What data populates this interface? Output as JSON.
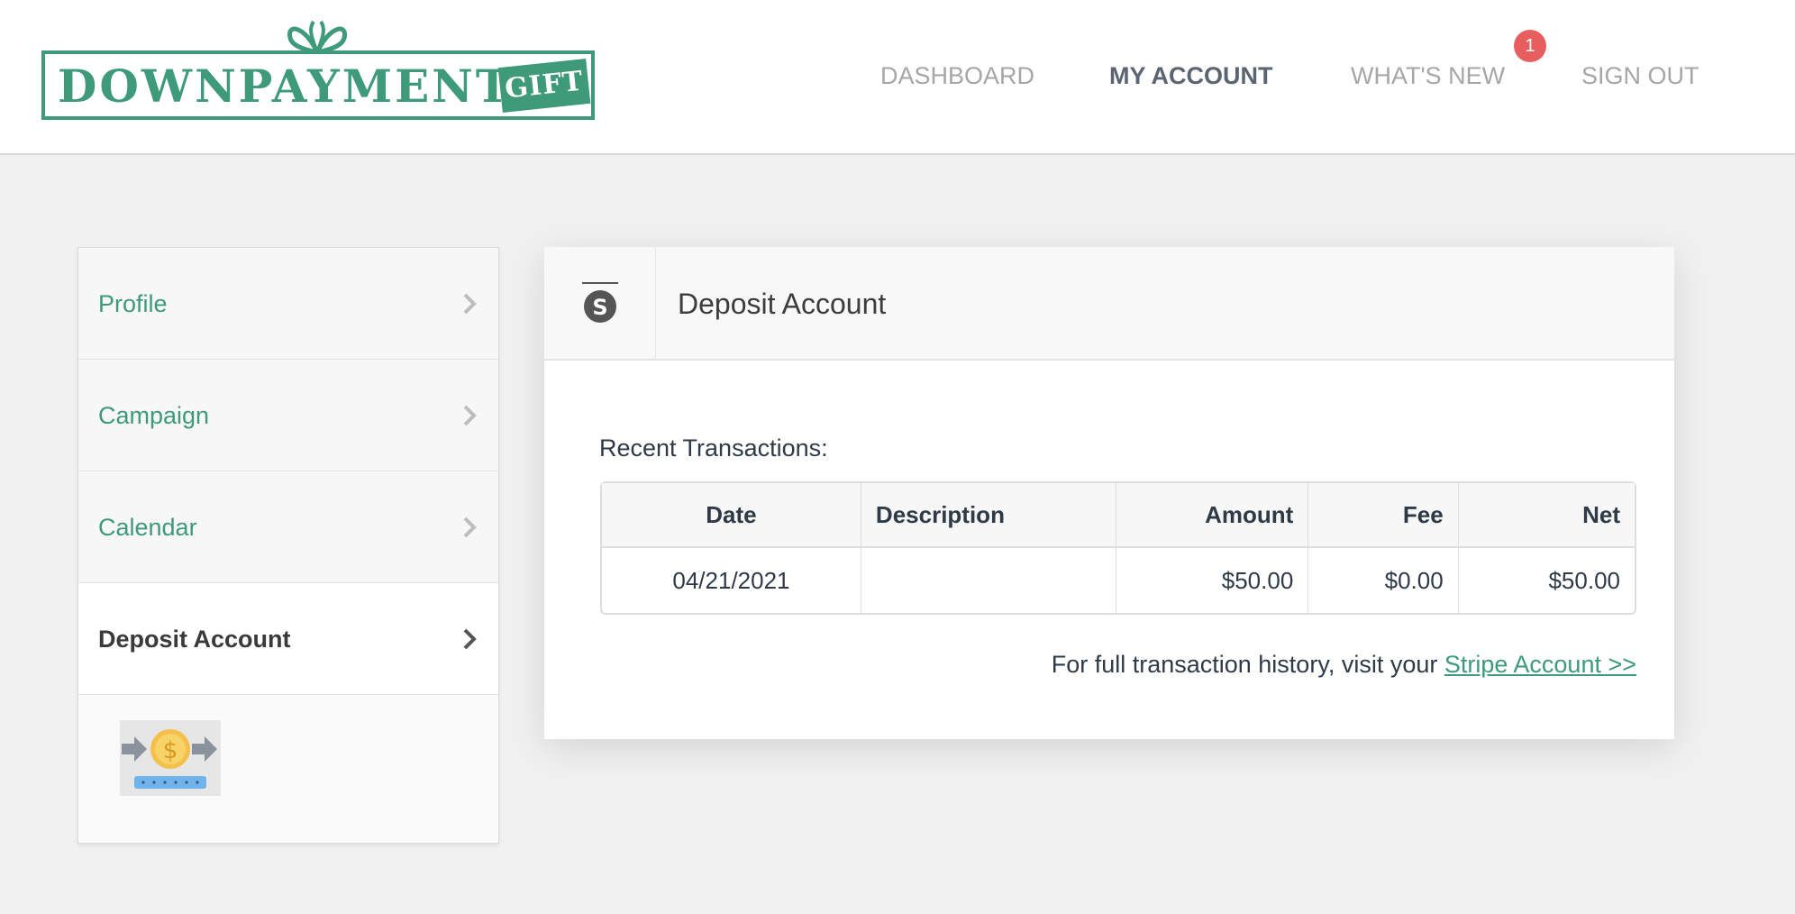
{
  "header": {
    "logo_text": "DOWNPAYMENT.",
    "logo_tag": "GIFT",
    "nav": {
      "dashboard": "DASHBOARD",
      "my_account": "MY ACCOUNT",
      "whats_new": "WHAT'S NEW",
      "sign_out": "SIGN OUT"
    },
    "whats_new_badge": "1"
  },
  "sidebar": {
    "items": [
      {
        "label": "Profile",
        "icon": "chevron-right-icon"
      },
      {
        "label": "Campaign",
        "icon": "chevron-right-icon"
      },
      {
        "label": "Calendar",
        "icon": "chevron-right-icon"
      },
      {
        "label": "Deposit Account",
        "icon": "chevron-right-icon",
        "active": true
      }
    ],
    "illustration": "money-transfer-icon"
  },
  "card": {
    "icon": "stripe-icon",
    "title": "Deposit Account",
    "recent_label": "Recent Transactions:",
    "table": {
      "headers": [
        "Date",
        "Description",
        "Amount",
        "Fee",
        "Net"
      ],
      "rows": [
        [
          "04/21/2021",
          "",
          "$50.00",
          "$0.00",
          "$50.00"
        ]
      ]
    },
    "history_prefix": "For full transaction history, visit your",
    "history_link": "Stripe Account >>"
  },
  "colors": {
    "brand_green": "#3e9a78",
    "badge_red": "#e85d5d",
    "nav_inactive": "#a6a6a6",
    "nav_active": "#5b6470"
  }
}
